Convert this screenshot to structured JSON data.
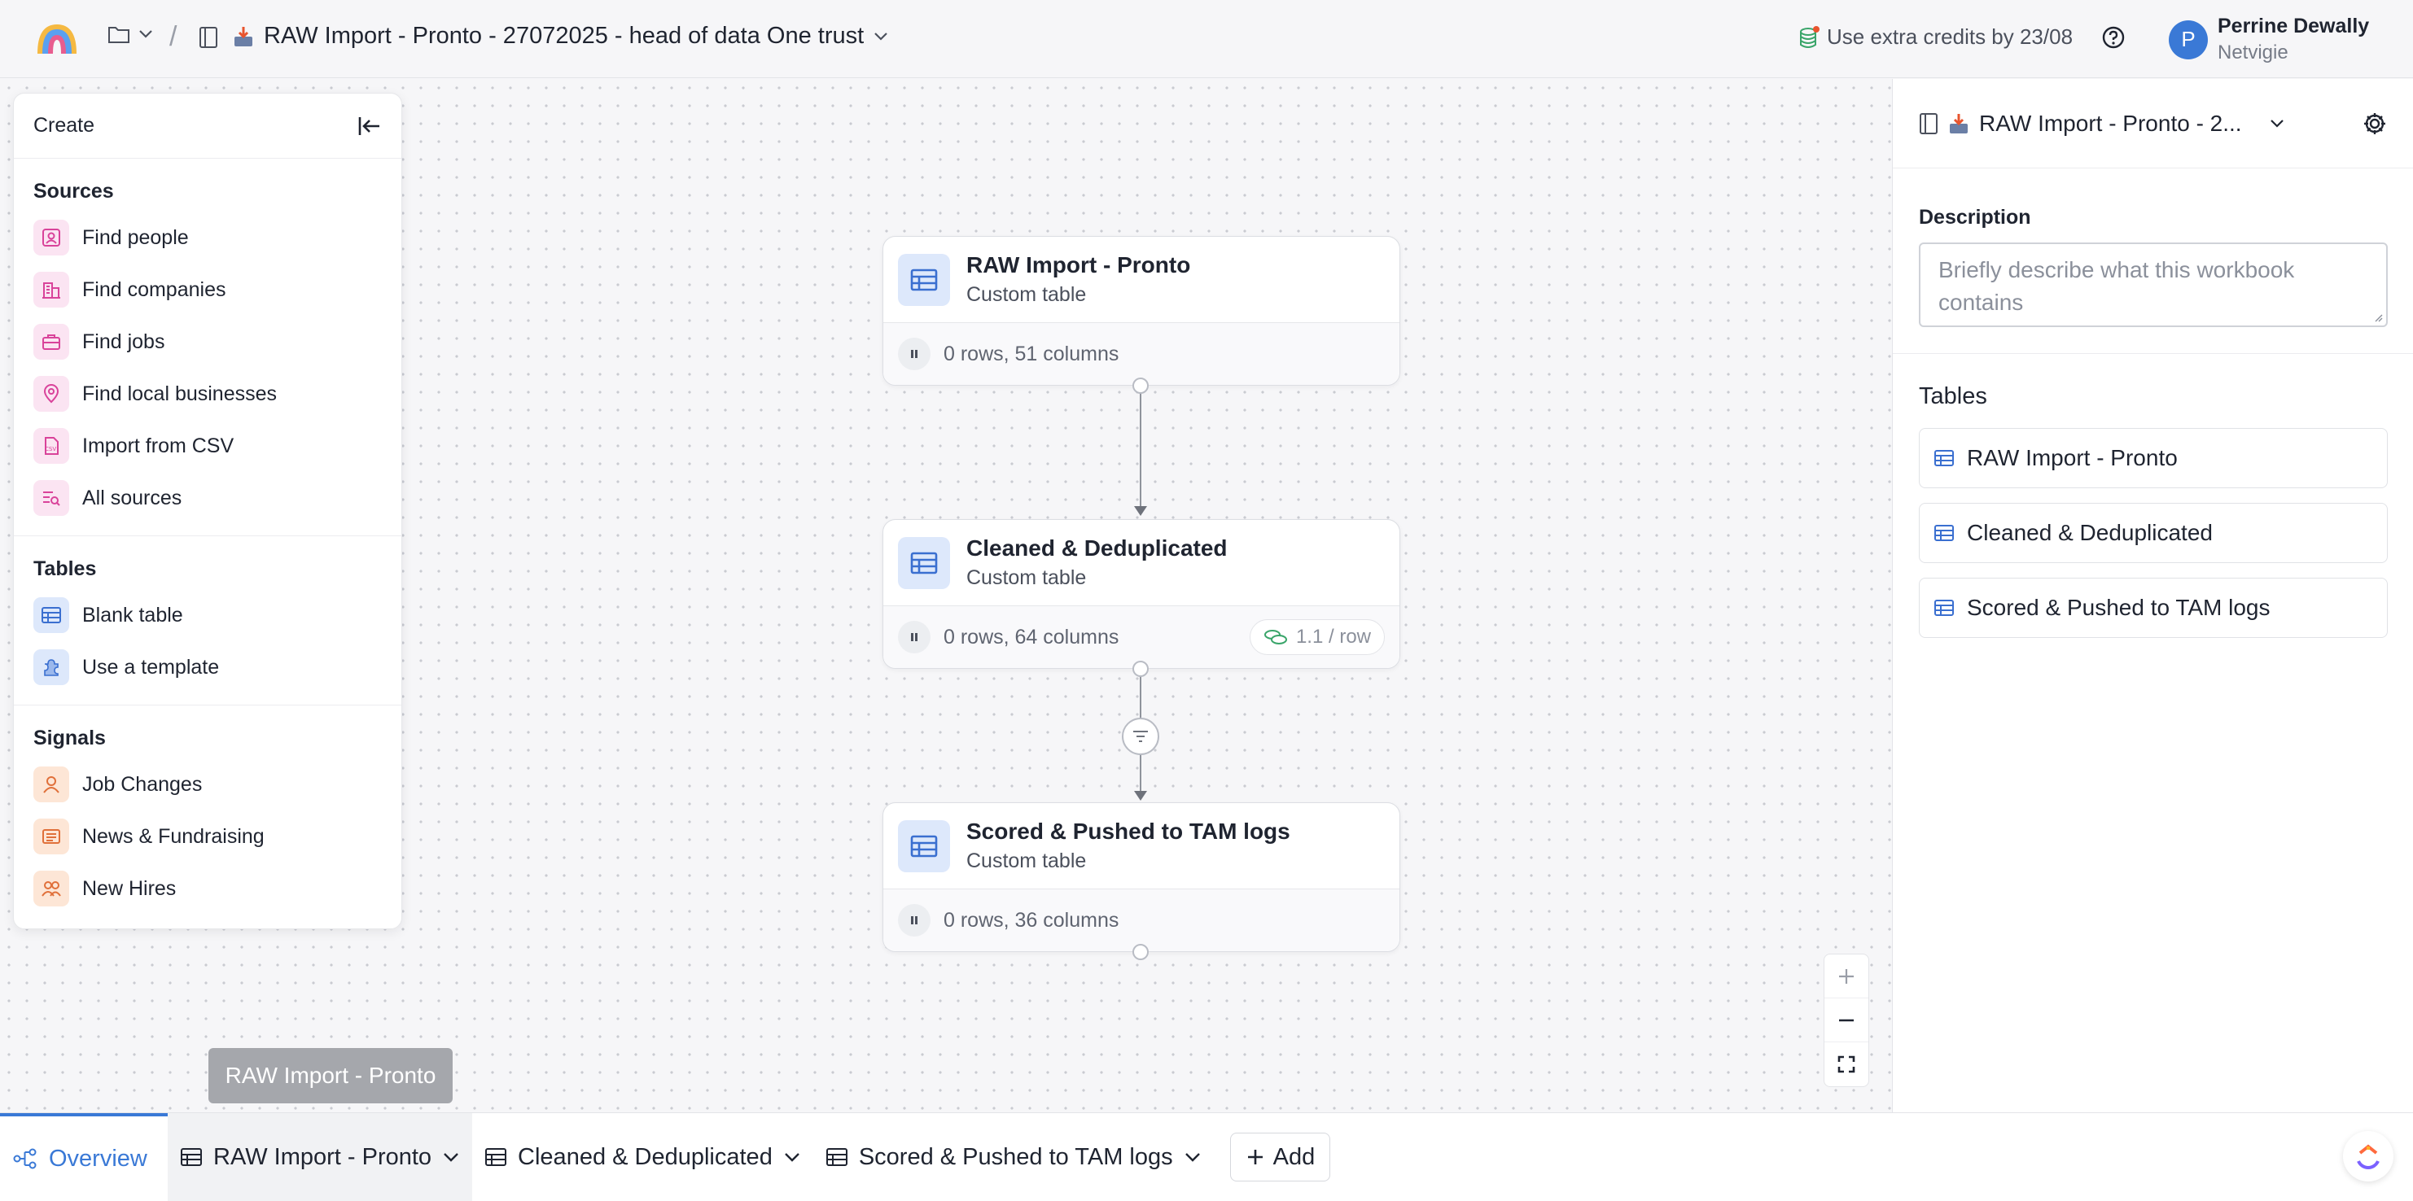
{
  "header": {
    "breadcrumb_title": "RAW Import - Pronto - 27072025 - head of data One trust",
    "credits_text": "Use extra credits by 23/08",
    "user": {
      "initial": "P",
      "name": "Perrine Dewally",
      "org": "Netvigie"
    }
  },
  "create_panel": {
    "title": "Create",
    "sections": [
      {
        "title": "Sources",
        "items": [
          "Find people",
          "Find companies",
          "Find jobs",
          "Find local businesses",
          "Import from CSV",
          "All sources"
        ]
      },
      {
        "title": "Tables",
        "items": [
          "Blank table",
          "Use a template"
        ]
      },
      {
        "title": "Signals",
        "items": [
          "Job Changes",
          "News & Fundraising",
          "New Hires"
        ]
      }
    ]
  },
  "nodes": [
    {
      "title": "RAW Import - Pronto",
      "subtitle": "Custom table",
      "stats": "0 rows, 51 columns"
    },
    {
      "title": "Cleaned & Deduplicated",
      "subtitle": "Custom table",
      "stats": "0 rows, 64 columns",
      "rate": "1.1 / row"
    },
    {
      "title": "Scored & Pushed to TAM logs",
      "subtitle": "Custom table",
      "stats": "0 rows, 36 columns"
    }
  ],
  "tooltip": "RAW Import - Pronto",
  "right_panel": {
    "title": "RAW Import - Pronto - 2...",
    "description_label": "Description",
    "description_placeholder": "Briefly describe what this workbook contains",
    "tables_label": "Tables",
    "tables": [
      "RAW Import - Pronto",
      "Cleaned & Deduplicated",
      "Scored & Pushed to TAM logs"
    ]
  },
  "bottom_tabs": {
    "overview": "Overview",
    "tabs": [
      "RAW Import - Pronto",
      "Cleaned & Deduplicated",
      "Scored & Pushed to TAM logs"
    ],
    "add_label": "Add"
  },
  "colors": {
    "accent": "#3a79d6",
    "icon_pink": "#d9439a",
    "icon_orange": "#e0703a",
    "icon_blue": "#3a6fd0"
  }
}
